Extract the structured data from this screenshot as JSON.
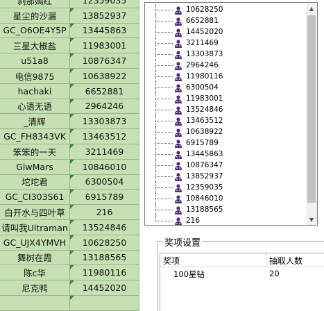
{
  "sheet": {
    "rows": [
      {
        "name": "刹那嫣红",
        "number": "12359035"
      },
      {
        "name": "星尘的沙漏",
        "number": "13852937"
      },
      {
        "name": "GC_O6OE4Y5P",
        "number": "13445863"
      },
      {
        "name": "三星大椒盐",
        "number": "11983001"
      },
      {
        "name": "u51a8",
        "number": "10876347"
      },
      {
        "name": "电信9875",
        "number": "10638922"
      },
      {
        "name": "hachaki",
        "number": "6652881"
      },
      {
        "name": "心语无语",
        "number": "2964246"
      },
      {
        "name": "_清辉",
        "number": "13303873"
      },
      {
        "name": "GC_FH8343VK",
        "number": "13463512"
      },
      {
        "name": "笨笨的一天",
        "number": "3211469"
      },
      {
        "name": "GlwMars",
        "number": "10846010"
      },
      {
        "name": "坨坨君",
        "number": "6300504"
      },
      {
        "name": "GC_CI303S61",
        "number": "6915789"
      },
      {
        "name": "白开水与四叶草",
        "number": "216"
      },
      {
        "name": "请叫我Ultraman",
        "number": "13524846"
      },
      {
        "name": "GC_UJX4YMVH",
        "number": "10628250"
      },
      {
        "name": "舞树在霞",
        "number": "13188565"
      },
      {
        "name": "陈c华",
        "number": "11980116"
      },
      {
        "name": "尼克鸭",
        "number": "14452020"
      }
    ]
  },
  "tree": {
    "items": [
      "10628250",
      "6652881",
      "14452020",
      "3211469",
      "13303873",
      "2964246",
      "11980116",
      "6300504",
      "11983001",
      "13524846",
      "13463512",
      "10638922",
      "6915789",
      "13445863",
      "10876347",
      "13852937",
      "12359035",
      "10846010",
      "13188565",
      "216"
    ],
    "icon": "person-icon",
    "scroll_up_icon": "▲",
    "scroll_down_icon": "▼"
  },
  "prize": {
    "group_title": "奖项设置",
    "col_prize": "奖项",
    "col_count": "抽取人数",
    "rows": [
      {
        "prize": "100星钻",
        "count": "20"
      }
    ]
  },
  "colors": {
    "sheet_bg": "#c6e0b4",
    "cell_marker": "#2e8b2e",
    "icon_purple": "#4a2f6e"
  }
}
